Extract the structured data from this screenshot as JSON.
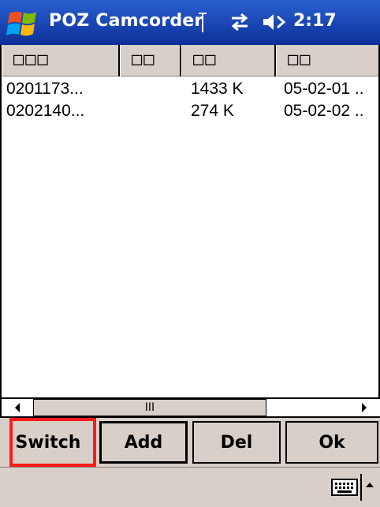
{
  "titlebar": {
    "app_title": "POZ Camcorder",
    "time": "2:17",
    "icons": [
      "windows-start-icon",
      "signal-icon",
      "connectivity-icon",
      "volume-icon"
    ]
  },
  "list": {
    "columns": [
      "□□□",
      "□□",
      "□□",
      "□□"
    ],
    "rows": [
      {
        "name": "0201173...",
        "size": "1433 K",
        "date": "05-02-01 .."
      },
      {
        "name": "0202140...",
        "size": "274 K",
        "date": "05-02-02 .."
      }
    ]
  },
  "scrollbar": {
    "thumb_grip": "III"
  },
  "buttons": {
    "switch": "Switch",
    "add": "Add",
    "del": "Del",
    "ok": "Ok"
  },
  "bottombar": {
    "icons": [
      "keyboard-icon",
      "sip-arrow-icon"
    ]
  },
  "colors": {
    "titlebar": "#1843b0",
    "chrome": "#d8cfc9",
    "highlight": "#ff1a1a"
  }
}
